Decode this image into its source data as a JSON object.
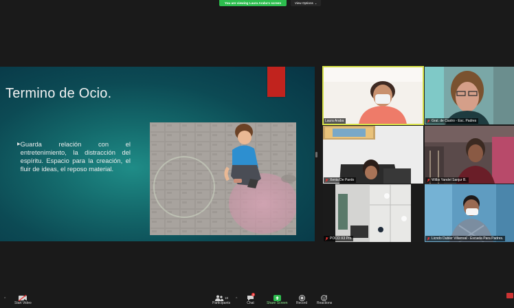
{
  "banner": {
    "viewing_text": "You are viewing Laura Araba's screen",
    "view_options_label": "View Options"
  },
  "slide": {
    "title": "Termino de Ocio.",
    "bullet": "Guarda relación con el entretenimiento, la distracción del espíritu. Espacio para la creación, el fluir de ideas, el reposo material."
  },
  "participants_gallery": [
    {
      "name": "Laura Araba"
    },
    {
      "name": "Gral. de Castro - Esc. Padres"
    },
    {
      "name": "Xenia De Pardo"
    },
    {
      "name": "Wilbs Yandel Sanjur B."
    },
    {
      "name": "POCO X3 Pro"
    },
    {
      "name": "Licndo Dubler Villarreal - Escuela Para Padres."
    }
  ],
  "toolbar": {
    "start_video": "Start Video",
    "participants": "Participants",
    "participants_count": "18",
    "chat": "Chat",
    "chat_badge": "4",
    "share_screen": "Share Screen",
    "record": "Record",
    "reactions": "Reactions"
  },
  "colors": {
    "banner_green": "#2dbd4e",
    "share_green": "#2dbd4e",
    "active_speaker": "#d8e34a",
    "slide_accent": "#c1231e"
  }
}
